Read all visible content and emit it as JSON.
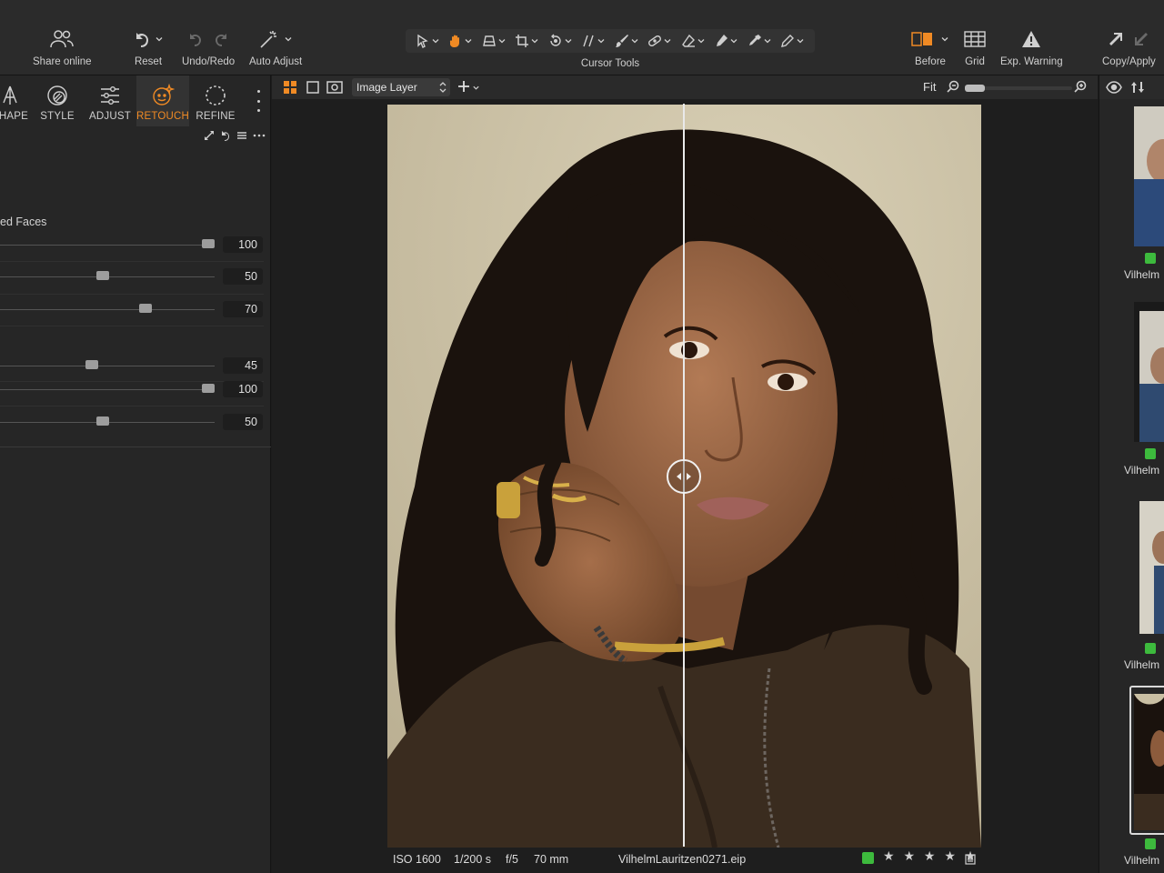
{
  "toolbar": {
    "share_label": "Share online",
    "reset_label": "Reset",
    "undo_redo_label": "Undo/Redo",
    "auto_adjust_label": "Auto Adjust",
    "cursor_tools_label": "Cursor Tools",
    "before_label": "Before",
    "grid_label": "Grid",
    "exp_warning_label": "Exp. Warning",
    "copy_apply_label": "Copy/Apply"
  },
  "tools": {
    "tabs": [
      {
        "label": "SHAPE",
        "icon": "shape-icon"
      },
      {
        "label": "STYLE",
        "icon": "style-icon"
      },
      {
        "label": "ADJUST",
        "icon": "adjust-icon"
      },
      {
        "label": "RETOUCH",
        "icon": "retouch-icon",
        "active": true
      },
      {
        "label": "REFINE",
        "icon": "refine-icon"
      }
    ],
    "section_title": "ed Faces",
    "sliders": [
      {
        "value": "100",
        "fraction": 0.97
      },
      {
        "value": "50",
        "fraction": 0.48
      },
      {
        "value": "70",
        "fraction": 0.68
      },
      {
        "value": "45",
        "fraction": 0.43
      },
      {
        "value": "100",
        "fraction": 0.97
      },
      {
        "value": "50",
        "fraction": 0.48
      }
    ]
  },
  "viewer": {
    "layer_select": "Image Layer",
    "zoom_label": "Fit",
    "split_compare": "before-after"
  },
  "metadata": {
    "iso": "ISO 1600",
    "shutter": "1/200 s",
    "aperture": "f/5",
    "focal": "70 mm",
    "filename": "VilhelmLauritzen0271.eip",
    "color_tag": "#3dba3d",
    "stars": "★ ★ ★ ★ ★"
  },
  "browser": {
    "thumbnails": [
      {
        "name": "Vilhelm"
      },
      {
        "name": "Vilhelm"
      },
      {
        "name": "Vilhelm"
      },
      {
        "name": "Vilhelm",
        "selected": true
      }
    ]
  },
  "colors": {
    "accent": "#f08a24",
    "tag_green": "#3dba3d",
    "panel_bg": "#262626",
    "toolbar_bg": "#2b2b2b"
  }
}
